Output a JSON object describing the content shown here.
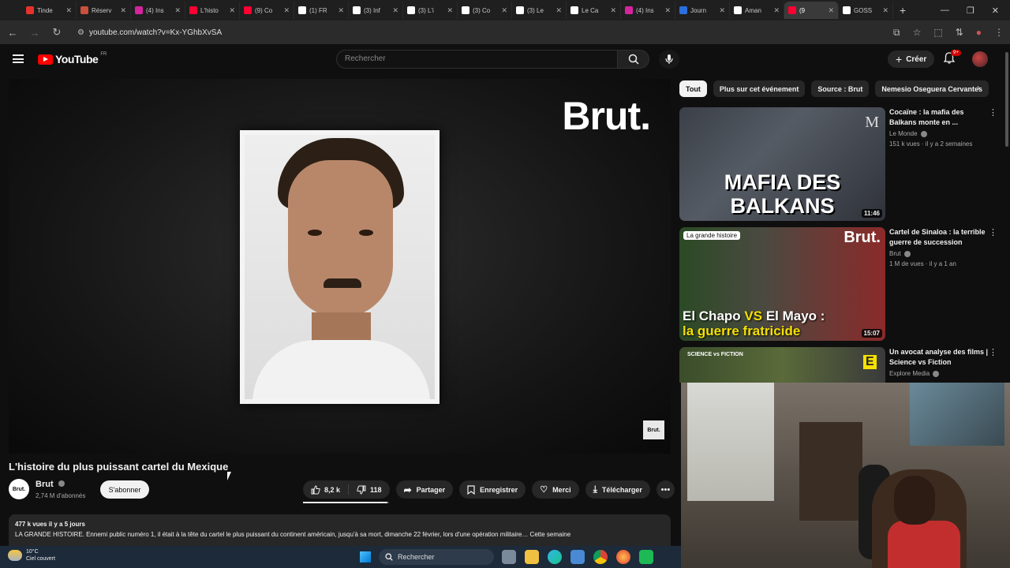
{
  "browser": {
    "tabs": [
      {
        "label": "Tinde",
        "color": "#e5322d"
      },
      {
        "label": "Réserv",
        "color": "#c8503c"
      },
      {
        "label": "(4) Ins",
        "color": "#d6249f"
      },
      {
        "label": "L'histo",
        "color": "#ff0033"
      },
      {
        "label": "(9) Co",
        "color": "#ff0033"
      },
      {
        "label": "(1) FR",
        "color": "#ffffff"
      },
      {
        "label": "(3) Inf",
        "color": "#ffffff"
      },
      {
        "label": "(3) L'i",
        "color": "#ffffff"
      },
      {
        "label": "(3) Co",
        "color": "#ffffff"
      },
      {
        "label": "(3) Le",
        "color": "#ffffff"
      },
      {
        "label": "Le Ca",
        "color": "#ffffff"
      },
      {
        "label": "(4) Ins",
        "color": "#d6249f"
      },
      {
        "label": "Journ",
        "color": "#2a6fdb"
      },
      {
        "label": "Aman",
        "color": "#ffffff"
      },
      {
        "label": "(9",
        "color": "#ff0033",
        "active": true
      },
      {
        "label": "GOSS",
        "color": "#ffffff"
      }
    ],
    "url": "youtube.com/watch?v=Kx-YGhbXvSA"
  },
  "header": {
    "logo_text": "YouTube",
    "region": "FR",
    "search_placeholder": "Rechercher",
    "create_label": "Créer",
    "notif_count": "9+"
  },
  "video": {
    "watermark": "Brut.",
    "corner_logo": "Brut.",
    "title": "L'histoire du plus puissant cartel du Mexique",
    "channel": {
      "name": "Brut",
      "avatar_text": "Brut.",
      "subscribers": "2,74 M d'abonnés"
    },
    "subscribe_label": "S'abonner",
    "likes": "8,2 k",
    "dislikes": "118",
    "like_ratio": 0.98,
    "actions": {
      "share": "Partager",
      "save": "Enregistrer",
      "thanks": "Merci",
      "download": "Télécharger"
    },
    "description": {
      "meta": "477 k vues  il y a 5 jours",
      "text": "LA GRANDE HISTOIRE. Ennemi public numéro 1, il était à la tête du cartel le plus puissant du continent américain, jusqu'à sa mort, dimanche 22 février, lors d'une opération militaire… Cette semaine"
    }
  },
  "sidebar": {
    "chips": [
      "Tout",
      "Plus sur cet événement",
      "Source : Brut",
      "Nemesio Oseguera Cervantes"
    ],
    "recommendations": [
      {
        "title": "Cocaïne : la mafia des Balkans monte en ...",
        "channel": "Le Monde",
        "meta": "151 k vues · il y a 2 semaines",
        "duration": "11:46",
        "thumb_text": "MAFIA DES BALKANS",
        "thumb_logo": "M"
      },
      {
        "title": "Cartel de Sinaloa : la terrible guerre de succession",
        "channel": "Brut",
        "meta": "1 M de vues · il y a 1 an",
        "duration": "15:07",
        "thumb_tag": "La grande histoire",
        "thumb_logo": "Brut.",
        "thumb_caption_a": "El Chapo",
        "thumb_caption_vs": "VS",
        "thumb_caption_b": "El Mayo :",
        "thumb_caption_c": "la guerre fratricide"
      },
      {
        "title": "Un avocat analyse des films | Science vs Fiction",
        "channel": "Explore Media",
        "thumb_tag": "SCIENCE vs FICTION",
        "thumb_logo": "E"
      }
    ]
  },
  "taskbar": {
    "temp": "10°C",
    "weather": "Ciel couvert",
    "search_label": "Rechercher"
  }
}
